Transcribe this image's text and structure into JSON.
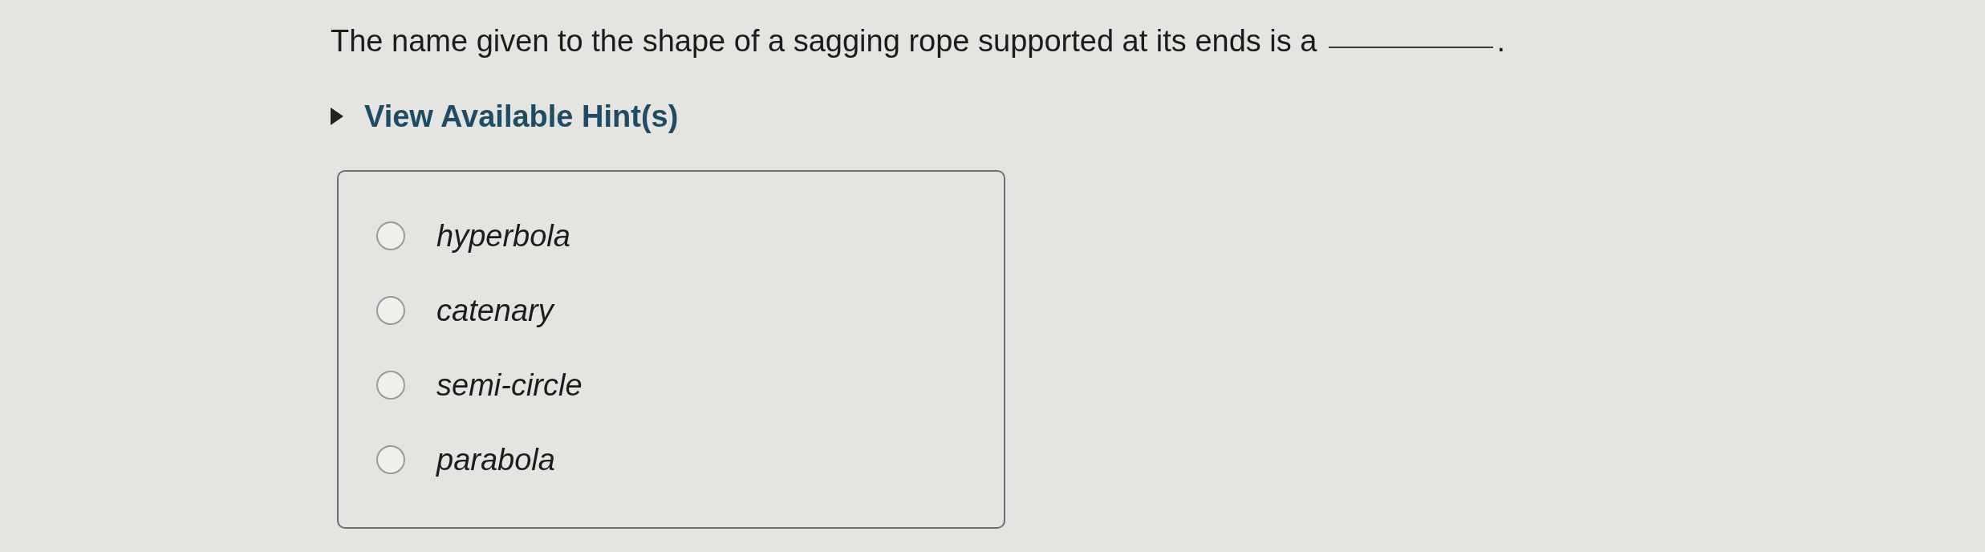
{
  "question": {
    "parts": [
      {
        "kind": "text",
        "text": "The name given to the shape of a sagging rope supported at its ends is a"
      },
      {
        "kind": "blank"
      },
      {
        "kind": "text",
        "text": "."
      }
    ]
  },
  "hint": {
    "label": "View Available Hint(s)",
    "expanded": false
  },
  "options": [
    {
      "label": "hyperbola",
      "selected": false
    },
    {
      "label": "catenary",
      "selected": false
    },
    {
      "label": "semi-circle",
      "selected": false
    },
    {
      "label": "parabola",
      "selected": false
    }
  ]
}
